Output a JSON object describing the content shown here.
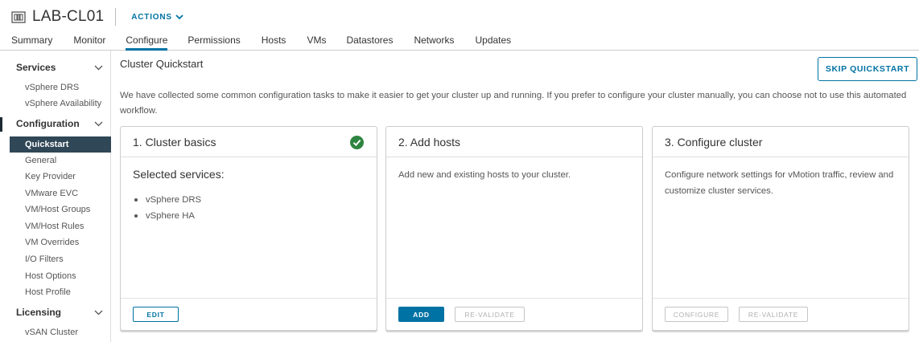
{
  "header": {
    "title": "LAB-CL01",
    "actions_label": "ACTIONS"
  },
  "tabs": [
    {
      "label": "Summary"
    },
    {
      "label": "Monitor"
    },
    {
      "label": "Configure"
    },
    {
      "label": "Permissions"
    },
    {
      "label": "Hosts"
    },
    {
      "label": "VMs"
    },
    {
      "label": "Datastores"
    },
    {
      "label": "Networks"
    },
    {
      "label": "Updates"
    }
  ],
  "active_tab": "Configure",
  "sidebar": {
    "groups": [
      {
        "label": "Services"
      },
      {
        "label": "Configuration"
      },
      {
        "label": "Licensing"
      }
    ],
    "items": [
      {
        "label": "vSphere DRS"
      },
      {
        "label": "vSphere Availability"
      },
      {
        "label": "Quickstart"
      },
      {
        "label": "General"
      },
      {
        "label": "Key Provider"
      },
      {
        "label": "VMware EVC"
      },
      {
        "label": "VM/Host Groups"
      },
      {
        "label": "VM/Host Rules"
      },
      {
        "label": "VM Overrides"
      },
      {
        "label": "I/O Filters"
      },
      {
        "label": "Host Options"
      },
      {
        "label": "Host Profile"
      },
      {
        "label": "vSAN Cluster"
      }
    ],
    "active_item": "Quickstart"
  },
  "main": {
    "title": "Cluster Quickstart",
    "skip_label": "SKIP QUICKSTART",
    "description": "We have collected some common configuration tasks to make it easier to get your cluster up and running. If you prefer to configure your cluster manually, you can choose not to use this automated workflow."
  },
  "cards": [
    {
      "title": "1. Cluster basics",
      "selected_title": "Selected services:",
      "services": [
        "vSphere DRS",
        "vSphere HA"
      ],
      "status_icon": "check-circle-icon",
      "buttons": [
        {
          "label": "EDIT"
        }
      ]
    },
    {
      "title": "2. Add hosts",
      "description": "Add new and existing hosts to your cluster.",
      "buttons": [
        {
          "label": "ADD"
        },
        {
          "label": "RE-VALIDATE"
        }
      ]
    },
    {
      "title": "3. Configure cluster",
      "description": "Configure network settings for vMotion traffic, review and customize cluster services.",
      "buttons": [
        {
          "label": "CONFIGURE"
        },
        {
          "label": "RE-VALIDATE"
        }
      ]
    }
  ],
  "colors": {
    "accent": "#0072a3",
    "success": "#2e8540",
    "sidebar_active_bg": "#2f4756"
  }
}
